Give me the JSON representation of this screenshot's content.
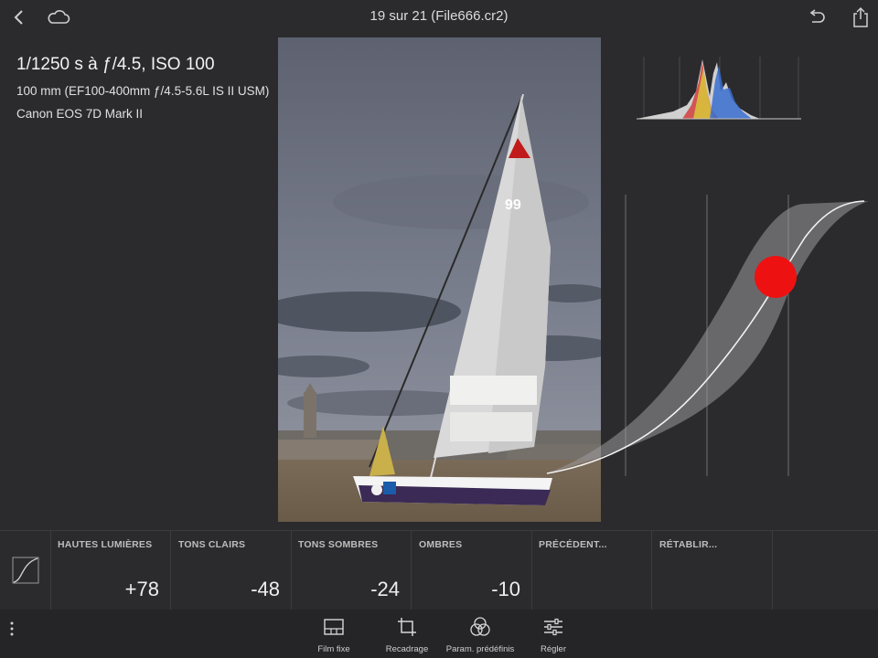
{
  "header": {
    "title": "19 sur 21 (File666.cr2)",
    "icons": [
      "back-chevron-icon",
      "cloud-icon",
      "undo-icon",
      "share-icon"
    ]
  },
  "info": {
    "exposure": "1/1250 s à ƒ/4.5, ISO 100",
    "lens": "100 mm (EF100-400mm ƒ/4.5-5.6L IS II USM)",
    "camera": "Canon EOS 7D Mark II"
  },
  "curve": {
    "handle_color": "#ee1111"
  },
  "adjustments": [
    {
      "label": "HAUTES LUMIÈRES",
      "value": "+78"
    },
    {
      "label": "TONS CLAIRS",
      "value": "-48"
    },
    {
      "label": "TONS SOMBRES",
      "value": "-24"
    },
    {
      "label": "OMBRES",
      "value": "-10"
    },
    {
      "label": "PRÉCÉDENT...",
      "value": ""
    },
    {
      "label": "RÉTABLIR...",
      "value": ""
    }
  ],
  "toolbar": {
    "items": [
      {
        "label": "Film fixe",
        "icon": "filmstrip-icon"
      },
      {
        "label": "Recadrage",
        "icon": "crop-icon"
      },
      {
        "label": "Param. prédéfinis",
        "icon": "presets-icon"
      },
      {
        "label": "Régler",
        "icon": "sliders-icon"
      }
    ]
  }
}
